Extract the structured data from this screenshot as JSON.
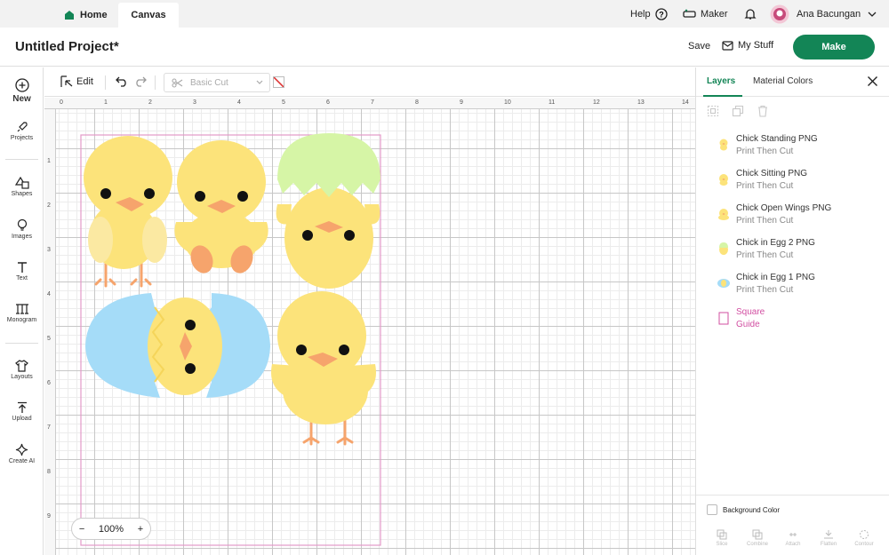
{
  "tabs": {
    "home": "Home",
    "canvas": "Canvas"
  },
  "header": {
    "help": "Help",
    "machine": "Maker",
    "user_name": "Ana Bacungan"
  },
  "project": {
    "title": "Untitled Project*",
    "save": "Save",
    "my_stuff": "My Stuff",
    "make": "Make"
  },
  "sidebar": {
    "new": "New",
    "projects": "Projects",
    "shapes": "Shapes",
    "images": "Images",
    "text": "Text",
    "monogram": "Monogram",
    "layouts": "Layouts",
    "upload": "Upload",
    "create_ai": "Create AI"
  },
  "toolbar": {
    "edit": "Edit",
    "operation": "Basic Cut"
  },
  "ruler": {
    "top": [
      "0",
      "1",
      "2",
      "3",
      "4",
      "5",
      "6",
      "7",
      "8",
      "9",
      "10",
      "11",
      "12",
      "13",
      "14"
    ],
    "left": [
      "1",
      "2",
      "3",
      "4",
      "5",
      "6",
      "7",
      "8",
      "9"
    ]
  },
  "zoom": {
    "minus": "−",
    "level": "100%",
    "plus": "+"
  },
  "panel": {
    "tab_layers": "Layers",
    "tab_material_colors": "Material Colors",
    "layers": [
      {
        "name": "Chick Standing PNG",
        "operation": "Print Then Cut"
      },
      {
        "name": "Chick Sitting PNG",
        "operation": "Print Then Cut"
      },
      {
        "name": "Chick Open Wings PNG",
        "operation": "Print Then Cut"
      },
      {
        "name": "Chick in Egg 2 PNG",
        "operation": "Print Then Cut"
      },
      {
        "name": "Chick in Egg 1 PNG",
        "operation": "Print Then Cut"
      },
      {
        "name": "Square",
        "operation": "Guide"
      }
    ],
    "background_color": "Background Color",
    "bottom_actions": [
      "Slice",
      "Combine",
      "Attach",
      "Flatten",
      "Contour"
    ]
  },
  "colors": {
    "accent_green": "#138556",
    "guide_pink": "#d24fa2",
    "chick_yellow": "#fce37a",
    "beak_orange": "#f6a46c",
    "egg_blue": "#a5dcf8",
    "shell_green": "#d6f5a6"
  }
}
